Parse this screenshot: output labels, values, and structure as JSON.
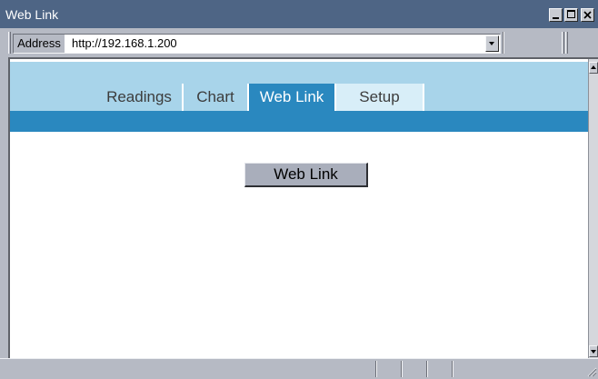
{
  "window": {
    "title": "Web Link",
    "icons": {
      "minimize": "minimize-icon",
      "maximize": "maximize-icon",
      "close": "close-icon"
    }
  },
  "address_bar": {
    "label": "Address",
    "url": "http://192.168.1.200",
    "dropdown_icon": "chevron-down-icon"
  },
  "page": {
    "tabs": [
      {
        "label": "Readings",
        "selected": false,
        "highlighted": false
      },
      {
        "label": "Chart",
        "selected": false,
        "highlighted": false
      },
      {
        "label": "Web Link",
        "selected": true,
        "highlighted": false
      },
      {
        "label": "Setup",
        "selected": false,
        "highlighted": true
      }
    ],
    "action_button": {
      "label": "Web Link"
    }
  },
  "scrollbar": {
    "up_icon": "scroll-up-icon",
    "down_icon": "scroll-down-icon"
  },
  "status_bar": {
    "grip_icon": "resize-grip-icon"
  },
  "colors": {
    "title_bar": "#4e6585",
    "chrome": "#b6bac4",
    "header_light": "#a8d4ea",
    "header_dark": "#2a88bf",
    "tab_selected": "#2a88bf",
    "tab_highlighted": "#d8eef8",
    "tab_text": "#3c3c3c",
    "button_face": "#a9aebb"
  }
}
